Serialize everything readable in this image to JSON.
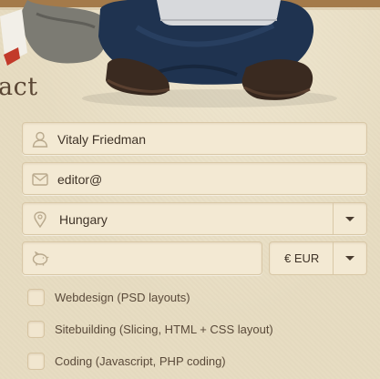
{
  "page": {
    "title": "act"
  },
  "form": {
    "name": {
      "value": "Vitaly Friedman",
      "icon": "user-icon"
    },
    "email": {
      "value": "editor@",
      "icon": "envelope-icon"
    },
    "country": {
      "value": "Hungary",
      "icon": "location-pin-icon"
    },
    "budget": {
      "value": "",
      "icon": "piggy-bank-icon"
    },
    "currency": {
      "value": "€ EUR"
    }
  },
  "services": [
    {
      "label": "Webdesign (PSD layouts)",
      "checked": false
    },
    {
      "label": "Sitebuilding (Slicing, HTML + CSS layout)",
      "checked": false
    },
    {
      "label": "Coding (Javascript, PHP coding)",
      "checked": false
    }
  ],
  "colors": {
    "background": "#e7dcc1",
    "field": "#f3e9d3",
    "border": "#d8c7a6",
    "text": "#4a3c30"
  }
}
